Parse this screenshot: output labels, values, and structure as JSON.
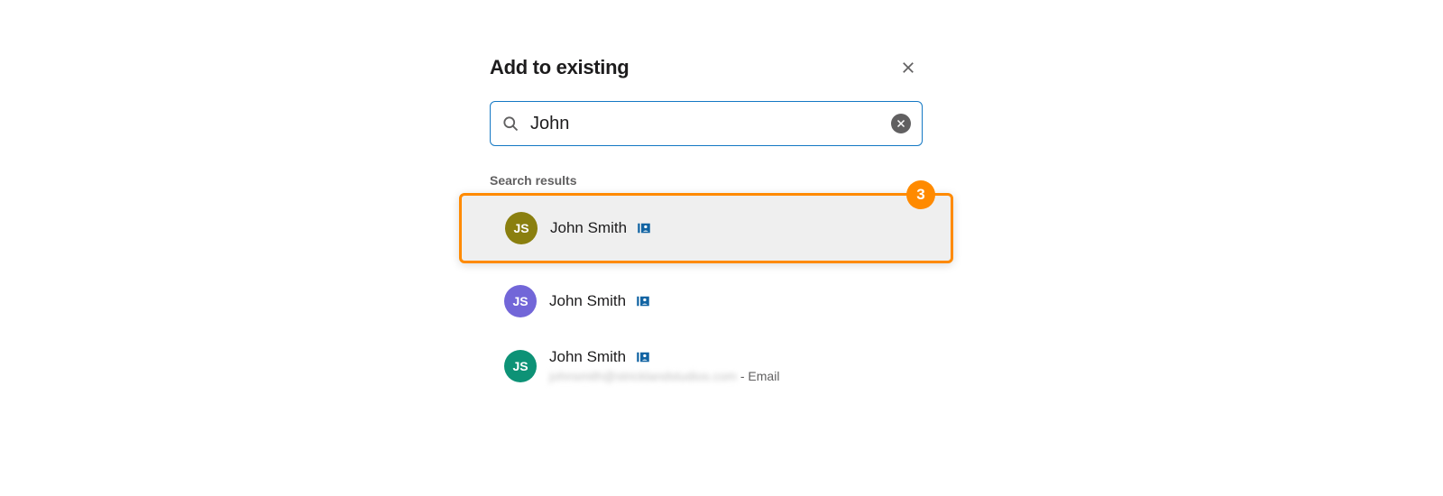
{
  "dialog": {
    "title": "Add to existing"
  },
  "search": {
    "value": "John"
  },
  "results_label": "Search results",
  "step_badge": "3",
  "results": [
    {
      "initials": "JS",
      "name": "John Smith",
      "avatar_color": "olive",
      "highlighted": true
    },
    {
      "initials": "JS",
      "name": "John Smith",
      "avatar_color": "purple",
      "highlighted": false
    },
    {
      "initials": "JS",
      "name": "John Smith",
      "avatar_color": "teal",
      "highlighted": false,
      "sub_email": "johnsmith@stricklandstudios.com",
      "sub_type": "Email"
    }
  ]
}
